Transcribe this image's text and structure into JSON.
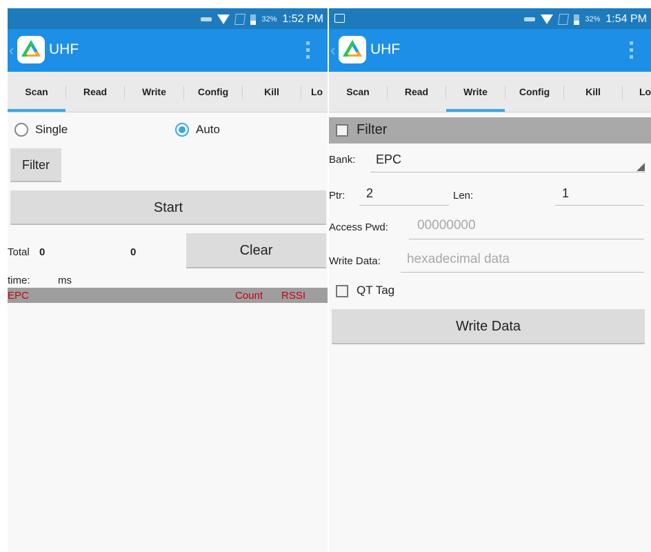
{
  "left": {
    "status": {
      "battery_pct": "32%",
      "time": "1:52 PM"
    },
    "app_title": "UHF",
    "tabs": [
      "Scan",
      "Read",
      "Write",
      "Config",
      "Kill",
      "Lo"
    ],
    "active_tab": "Scan",
    "scan": {
      "mode_single": "Single",
      "mode_auto": "Auto",
      "selected_mode": "Auto",
      "filter_button": "Filter",
      "start_button": "Start",
      "total_label": "Total",
      "total_value": "0",
      "count_value": "0",
      "clear_button": "Clear",
      "time_label": "time:",
      "time_unit": "ms",
      "col_epc": "EPC",
      "col_count": "Count",
      "col_rssi": "RSSI"
    }
  },
  "right": {
    "status": {
      "battery_pct": "32%",
      "time": "1:54 PM"
    },
    "app_title": "UHF",
    "tabs": [
      "Scan",
      "Read",
      "Write",
      "Config",
      "Kill",
      "Lo"
    ],
    "active_tab": "Write",
    "write": {
      "filter_label": "Filter",
      "bank_label": "Bank:",
      "bank_value": "EPC",
      "ptr_label": "Ptr:",
      "ptr_value": "2",
      "len_label": "Len:",
      "len_value": "1",
      "access_pwd_label": "Access Pwd:",
      "access_pwd_placeholder": "00000000",
      "write_data_label": "Write Data:",
      "write_data_placeholder": "hexadecimal data",
      "qt_tag_label": "QT Tag",
      "write_button": "Write Data"
    }
  },
  "colors": {
    "status_bar": "#1d7bbd",
    "app_bar": "#1e8fe6",
    "tab_indicator": "#39a9e6",
    "header_text": "#c8000f"
  },
  "icons": [
    "usb-icon",
    "wifi-icon",
    "no-sim-icon",
    "battery-icon",
    "image-notification-icon",
    "app-logo-icon",
    "overflow-menu-icon",
    "back-icon"
  ]
}
